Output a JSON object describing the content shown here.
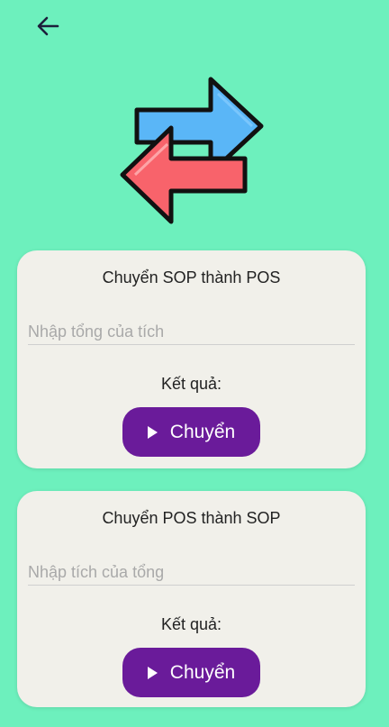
{
  "icons": {
    "back": "arrow-left",
    "hero": "swap-arrows",
    "play": "play-triangle"
  },
  "colors": {
    "background": "#6df0bd",
    "card": "#f1f0ea",
    "button": "#6a1b9a",
    "arrow_blue": "#5ab6f7",
    "arrow_red": "#f8636b"
  },
  "cards": [
    {
      "title": "Chuyển SOP thành POS",
      "input_placeholder": "Nhập tổng của tích",
      "input_value": "",
      "result_label": "Kết quả:",
      "button_label": "Chuyển"
    },
    {
      "title": "Chuyển POS thành SOP",
      "input_placeholder": "Nhập tích của tổng",
      "input_value": "",
      "result_label": "Kết quả:",
      "button_label": "Chuyển"
    }
  ]
}
